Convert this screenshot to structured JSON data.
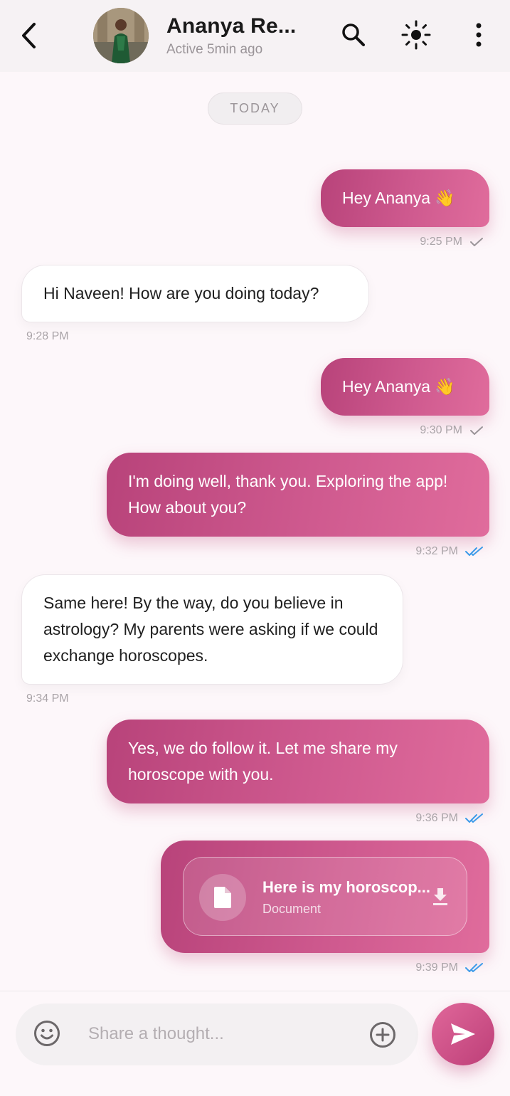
{
  "header": {
    "contact_name": "Ananya Re...",
    "status": "Active 5min ago"
  },
  "day_label": "TODAY",
  "messages": [
    {
      "text": "Hey Ananya 👋",
      "time": "9:25 PM",
      "direction": "sent",
      "status": "sent"
    },
    {
      "text": "Hi Naveen! How are you doing today?",
      "time": "9:28 PM",
      "direction": "received"
    },
    {
      "text": "Hey Ananya 👋",
      "time": "9:30 PM",
      "direction": "sent",
      "status": "sent"
    },
    {
      "text": "I'm doing well, thank you. Exploring the app! How about you?",
      "time": "9:32 PM",
      "direction": "sent",
      "status": "read"
    },
    {
      "text": "Same here! By the way, do you believe in astrology? My parents were asking if we could exchange horoscopes.",
      "time": "9:34 PM",
      "direction": "received"
    },
    {
      "text": "Yes, we do follow it. Let me share my horoscope with you.",
      "time": "9:36 PM",
      "direction": "sent",
      "status": "read"
    },
    {
      "attachment": {
        "title": "Here is my horoscop...",
        "type": "Document"
      },
      "time": "9:39 PM",
      "direction": "sent",
      "status": "read"
    }
  ],
  "composer": {
    "placeholder": "Share a thought..."
  },
  "colors": {
    "accent": "#c94a85",
    "read_tick": "#3d9be9",
    "sent_tick": "#9b9599"
  },
  "icons": [
    "back-arrow-icon",
    "search-icon",
    "brightness-icon",
    "more-vertical-icon",
    "file-icon",
    "download-icon",
    "emoji-icon",
    "add-circle-icon",
    "send-icon"
  ]
}
